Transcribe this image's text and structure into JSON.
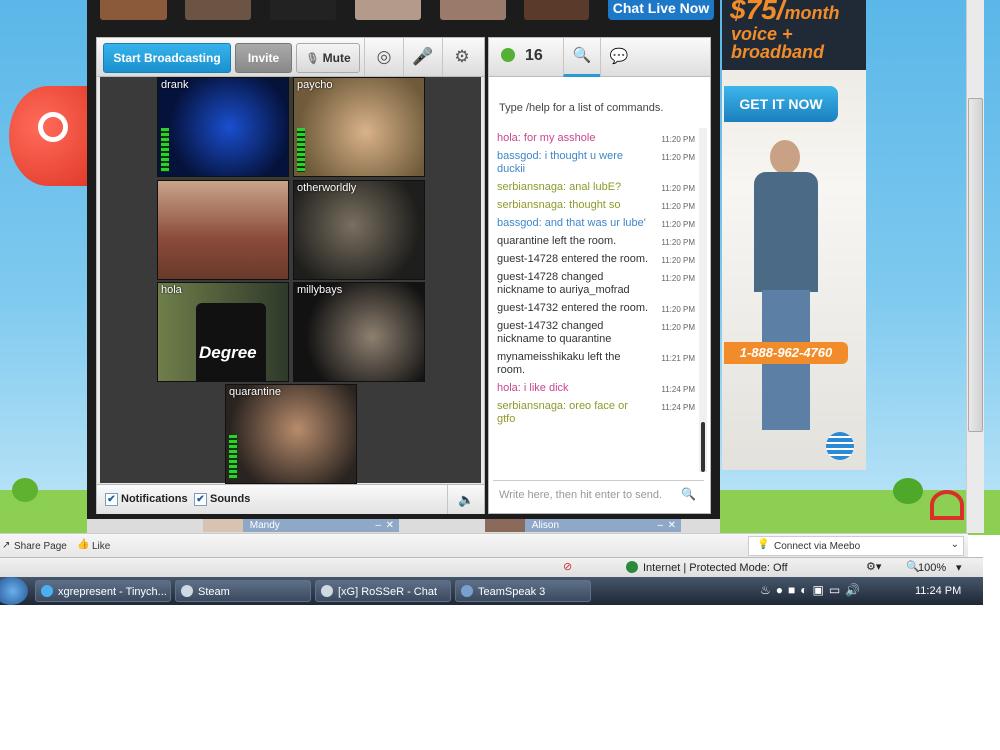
{
  "top": {
    "chat_live_label": "Chat Live Now"
  },
  "toolbar": {
    "broadcast_label": "Start Broadcasting",
    "invite_label": "Invite",
    "mute_label": "Mute",
    "icons": [
      "camera-icon",
      "microphone-icon",
      "gear-icon"
    ]
  },
  "videos": [
    {
      "name": "drank"
    },
    {
      "name": "paycho"
    },
    {
      "name": ""
    },
    {
      "name": "otherworldly"
    },
    {
      "name": "hola"
    },
    {
      "name": "millybays"
    },
    {
      "name": "quarantine"
    }
  ],
  "degree_text": "Degree",
  "footer": {
    "notifications_label": "Notifications",
    "sounds_label": "Sounds"
  },
  "chat": {
    "user_count": "16",
    "help_text": "Type /help for a list of commands.",
    "input_placeholder": "Write here, then hit enter to send.",
    "messages": [
      {
        "text": "hola: for my asshole",
        "time": "11:20 PM",
        "color": "#c8468e"
      },
      {
        "text": "bassgod: i thought u were duckii",
        "time": "11:20 PM",
        "color": "#3f86c9"
      },
      {
        "text": "serbiansnaga: anal lubE?",
        "time": "11:20 PM",
        "color": "#8f9a2c"
      },
      {
        "text": "serbiansnaga: thought so",
        "time": "11:20 PM",
        "color": "#8f9a2c"
      },
      {
        "text": "bassgod: and that was ur lube'",
        "time": "11:20 PM",
        "color": "#3f86c9"
      },
      {
        "text": "quarantine left the room.",
        "time": "11:20 PM",
        "color": "#333333"
      },
      {
        "text": "guest-14728 entered the room.",
        "time": "11:20 PM",
        "color": "#333333"
      },
      {
        "text": "guest-14728 changed nickname to auriya_mofrad",
        "time": "11:20 PM",
        "color": "#333333"
      },
      {
        "text": "guest-14732 entered the room.",
        "time": "11:20 PM",
        "color": "#333333"
      },
      {
        "text": "guest-14732 changed nickname to quarantine",
        "time": "11:20 PM",
        "color": "#333333"
      },
      {
        "text": "mynameisshikaku left the room.",
        "time": "11:21 PM",
        "color": "#333333"
      },
      {
        "text": "hola: i like dick",
        "time": "11:24 PM",
        "color": "#c8468e"
      },
      {
        "text": "serbiansnaga: oreo face or gtfo",
        "time": "11:24 PM",
        "color": "#8f9a2c"
      }
    ]
  },
  "ad": {
    "price": "$75/",
    "per": "month",
    "line1": "voice +",
    "line2": "broadband",
    "cta": "GET IT NOW",
    "phone": "1-888-962-4760"
  },
  "docks": [
    "Mandy",
    "Alison"
  ],
  "sharebar": {
    "share_label": "Share Page",
    "like_label": "Like",
    "meebo_label": "Connect via Meebo"
  },
  "status": {
    "zone_label": "Internet | Protected Mode: Off",
    "zoom": "100%"
  },
  "taskbar": {
    "tasks": [
      "xgrepresent - Tinych...",
      "Steam",
      "[xG] RoSSeR - Chat",
      "TeamSpeak 3"
    ],
    "clock": "11:24 PM"
  }
}
